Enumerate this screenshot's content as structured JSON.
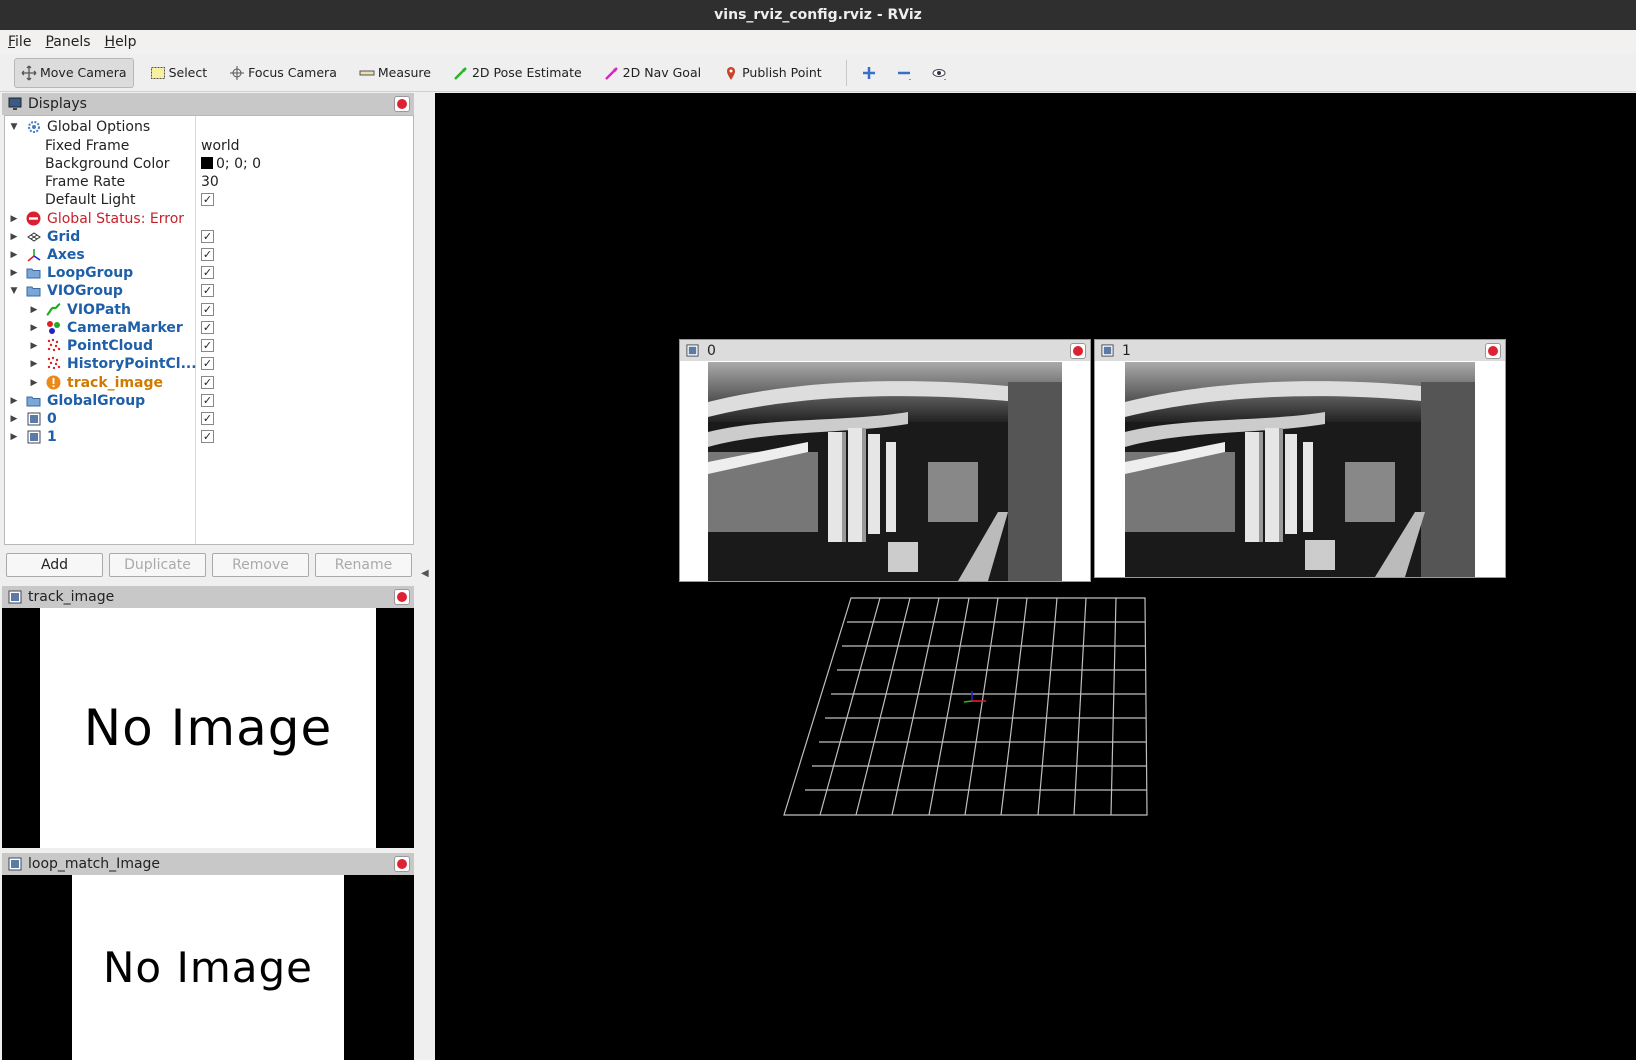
{
  "window": {
    "title": "vins_rviz_config.rviz - RViz"
  },
  "menu": [
    "File",
    "Panels",
    "Help"
  ],
  "toolbar": {
    "move_camera": "Move Camera",
    "select": "Select",
    "focus_camera": "Focus Camera",
    "measure": "Measure",
    "pose_estimate": "2D Pose Estimate",
    "nav_goal": "2D Nav Goal",
    "publish_point": "Publish Point"
  },
  "displays": {
    "title": "Displays",
    "global_options": "Global Options",
    "fixed_frame_label": "Fixed Frame",
    "fixed_frame_value": "world",
    "bg_color_label": "Background Color",
    "bg_color_value": "0; 0; 0",
    "frame_rate_label": "Frame Rate",
    "frame_rate_value": "30",
    "default_light_label": "Default Light",
    "global_status": "Global Status: Error",
    "items": {
      "grid": "Grid",
      "axes": "Axes",
      "loopgroup": "LoopGroup",
      "viogroup": "VIOGroup",
      "viopath": "VIOPath",
      "cameramarker": "CameraMarker",
      "pointcloud": "PointCloud",
      "historypointcloud": "HistoryPointCl...",
      "track_image": "track_image",
      "globalgroup": "GlobalGroup",
      "zero": "0",
      "one": "1"
    },
    "buttons": {
      "add": "Add",
      "duplicate": "Duplicate",
      "remove": "Remove",
      "rename": "Rename"
    }
  },
  "panels": {
    "track_image": {
      "title": "track_image",
      "no_image": "No Image"
    },
    "loop_match": {
      "title": "loop_match_Image",
      "no_image": "No Image"
    }
  },
  "camera_windows": [
    {
      "title": "0"
    },
    {
      "title": "1"
    }
  ],
  "colors": {
    "error": "#c8202a",
    "link": "#1f5fa8",
    "warning": "#d07a00",
    "viewport_bg": "#000000"
  }
}
